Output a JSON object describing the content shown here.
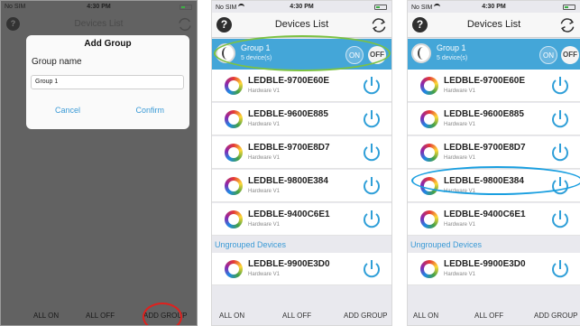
{
  "status": {
    "carrier": "No SIM",
    "time": "4:30 PM"
  },
  "nav": {
    "title": "Devices List",
    "help": "?"
  },
  "group": {
    "name": "Group 1",
    "count": "5 device(s)",
    "on": "ON",
    "off": "OFF"
  },
  "devices": [
    {
      "name": "LEDBLE-9700E60E",
      "hw": "Hardware V1"
    },
    {
      "name": "LEDBLE-9600E885",
      "hw": "Hardware V1"
    },
    {
      "name": "LEDBLE-9700E8D7",
      "hw": "Hardware V1"
    },
    {
      "name": "LEDBLE-9800E384",
      "hw": "Hardware V1"
    },
    {
      "name": "LEDBLE-9400C6E1",
      "hw": "Hardware V1"
    }
  ],
  "ungrouped_label": "Ungrouped Devices",
  "ungrouped": [
    {
      "name": "LEDBLE-9900E3D0",
      "hw": "Hardware V1"
    }
  ],
  "bottom": {
    "all_on": "ALL ON",
    "all_off": "ALL OFF",
    "add_group": "ADD GROUP"
  },
  "dialog": {
    "title": "Add Group",
    "label": "Group name",
    "input_value": "Group 1",
    "cancel": "Cancel",
    "confirm": "Confirm"
  },
  "colors": {
    "accent": "#44a6d8",
    "highlight_green": "#7cc242",
    "highlight_blue": "#1a9fe0",
    "highlight_red": "#e0201d",
    "overlay": "#626262"
  }
}
